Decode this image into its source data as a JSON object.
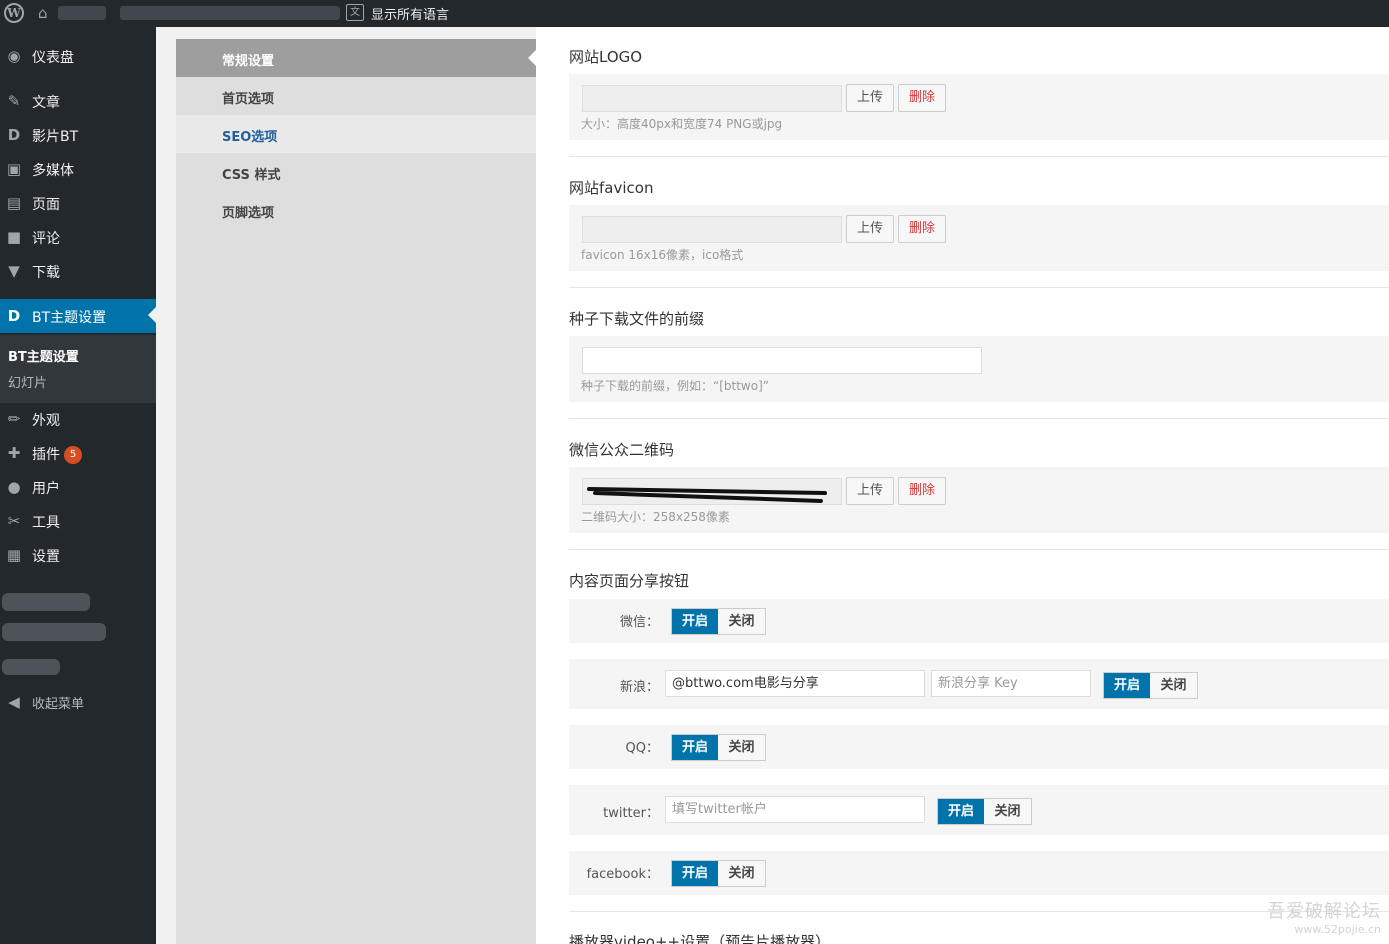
{
  "admin_bar": {
    "logo_glyph": "W",
    "home_glyph": "⌂",
    "lang_glyph": "文",
    "language_label": "显示所有语言"
  },
  "admin_menu": {
    "items": [
      {
        "label": "仪表盘",
        "icon": "dashboard-icon",
        "glyph": "◉"
      },
      {
        "label": "文章",
        "icon": "pin-icon",
        "glyph": "✎"
      },
      {
        "label": "影片BT",
        "icon": "d-icon",
        "glyph": "D"
      },
      {
        "label": "多媒体",
        "icon": "media-icon",
        "glyph": "▣"
      },
      {
        "label": "页面",
        "icon": "page-icon",
        "glyph": "▤"
      },
      {
        "label": "评论",
        "icon": "comment-icon",
        "glyph": "■"
      },
      {
        "label": "下载",
        "icon": "download-icon",
        "glyph": "▼"
      },
      {
        "label": "BT主题设置",
        "icon": "d-icon",
        "glyph": "D"
      },
      {
        "label": "外观",
        "icon": "appearance-icon",
        "glyph": "✏"
      },
      {
        "label": "插件",
        "icon": "plugin-icon",
        "glyph": "✚",
        "badge": "5"
      },
      {
        "label": "用户",
        "icon": "user-icon",
        "glyph": "●"
      },
      {
        "label": "工具",
        "icon": "wrench-icon",
        "glyph": "✂"
      },
      {
        "label": "设置",
        "icon": "settings-icon",
        "glyph": "▦"
      },
      {
        "label": "收起菜单",
        "icon": "collapse-icon",
        "glyph": "◀"
      }
    ],
    "submenu": [
      "BT主题设置",
      "幻灯片"
    ]
  },
  "tabs": [
    "常规设置",
    "首页选项",
    "SEO选项",
    "CSS 样式",
    "页脚选项"
  ],
  "sections": {
    "logo": {
      "title": "网站LOGO",
      "upload": "上传",
      "delete": "删除",
      "hint": "大小：高度40px和宽度74 PNG或jpg"
    },
    "favicon": {
      "title": "网站favicon",
      "upload": "上传",
      "delete": "删除",
      "hint": "favicon 16x16像素，ico格式"
    },
    "torrent": {
      "title": "种子下载文件的前缀",
      "hint": "种子下载的前缀，例如：“[bttwo]”"
    },
    "wechat_qr": {
      "title": "微信公众二维码",
      "upload": "上传",
      "delete": "删除",
      "hint": "二维码大小：258x258像素"
    },
    "share": {
      "title": "内容页面分享按钮",
      "on": "开启",
      "off": "关闭",
      "weixin_label": "微信：",
      "weibo_label": "新浪：",
      "weibo_value": "@bttwo.com电影与分享",
      "weibo_key_placeholder": "新浪分享 Key",
      "qq_label": "QQ：",
      "twitter_label": "twitter：",
      "twitter_placeholder": "填写twitter帐户",
      "facebook_label": "facebook："
    },
    "player": {
      "title": "播放器video++设置（预告片播放器）"
    }
  },
  "watermark": {
    "line1": "吾爱破解论坛",
    "line2": "www.52pojie.cn"
  }
}
